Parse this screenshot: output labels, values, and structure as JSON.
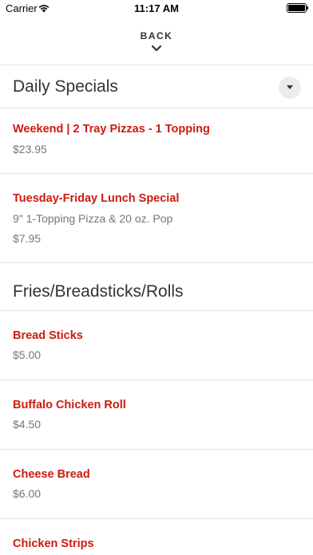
{
  "status_bar": {
    "carrier": "Carrier",
    "time": "11:17 AM"
  },
  "nav": {
    "back_label": "BACK"
  },
  "sections": [
    {
      "title": "Daily Specials",
      "items": [
        {
          "name": "Weekend | 2 Tray Pizzas - 1 Topping",
          "price": "$23.95"
        },
        {
          "name": "Tuesday-Friday Lunch Special",
          "description": "9\" 1-Topping Pizza & 20 oz. Pop",
          "price": "$7.95"
        }
      ]
    },
    {
      "title": "Fries/Breadsticks/Rolls",
      "items": [
        {
          "name": "Bread Sticks",
          "price": "$5.00"
        },
        {
          "name": "Buffalo Chicken Roll",
          "price": "$4.50"
        },
        {
          "name": "Cheese Bread",
          "price": "$6.00"
        },
        {
          "name": "Chicken Strips"
        }
      ]
    }
  ],
  "colors": {
    "item_name": "#cc1a0e",
    "secondary_text": "#777777",
    "divider": "#e6e6e6"
  }
}
